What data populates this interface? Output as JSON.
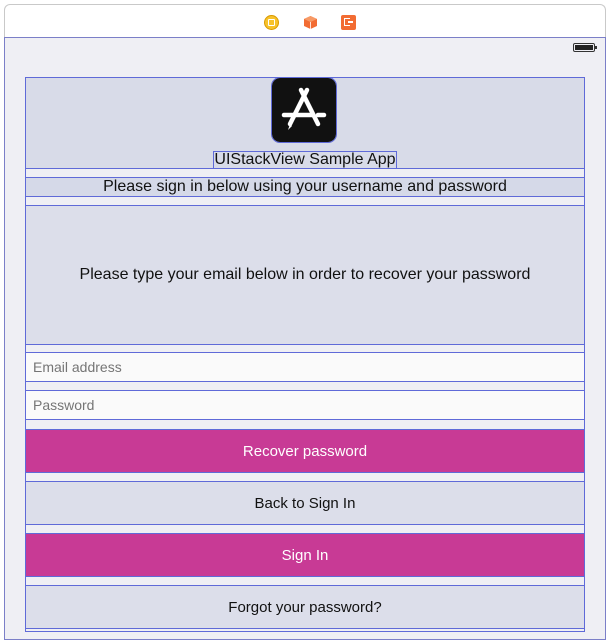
{
  "dock": {
    "icons": [
      "view-controller-icon",
      "first-responder-icon",
      "exit-icon"
    ],
    "colors": {
      "view_controller": "#f7c22b",
      "first_responder": "#f26c33",
      "exit": "#f26c33"
    }
  },
  "status_bar": {
    "battery_icon": "battery-icon"
  },
  "header": {
    "app_icon": "app-store-icon",
    "title": "UIStackView Sample App"
  },
  "subtitle": "Please sign in below using your username and password",
  "recover_info": "Please type your email below in order to recover your password",
  "form": {
    "email_placeholder": "Email address",
    "password_placeholder": "Password"
  },
  "buttons": {
    "recover": "Recover password",
    "back": "Back to Sign In",
    "sign_in": "Sign In",
    "forgot": "Forgot your password?"
  },
  "colors": {
    "primary_button": "#c83a95",
    "outline": "#5f6ad8",
    "canvas_bg": "#efeff4"
  }
}
